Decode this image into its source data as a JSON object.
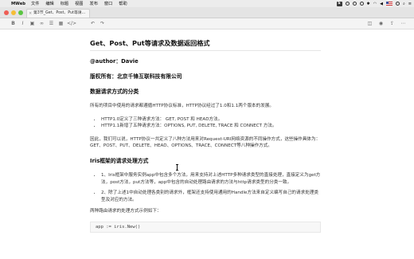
{
  "menubar": {
    "app_name": "MWeb",
    "items": [
      "文件",
      "编辑",
      "标题",
      "视图",
      "发布",
      "窗口",
      "帮助"
    ],
    "status_badge": "S"
  },
  "tab": {
    "title": "第3节_Get、Post、Put等请..."
  },
  "toolbar": {
    "icons": [
      "bold-icon",
      "italic-icon",
      "image-icon",
      "link-icon",
      "list-icon",
      "table-icon",
      "code-icon",
      "undo-icon",
      "redo-icon",
      "split-view-icon",
      "preview-icon",
      "share-icon"
    ]
  },
  "doc": {
    "title": "Get、Post、Put等请求及数据返回格式",
    "author": "@author：Davie",
    "copyright": "版权所有：北京千锋互联科技有限公司",
    "section1_title": "数据请求方式的分类",
    "section1_p1": "所有的项目中使用的请求都遵循HTTP协议标准，HTTP协议经过了1.0和1.1两个版本的发展。",
    "section1_bullets": [
      "HTTP1.0定义了三种请求方法： GET, POST 和 HEAD方法。",
      "HTTP1.1新增了五种请求方法：OPTIONS, PUT, DELETE, TRACE 和 CONNECT 方法。"
    ],
    "section1_p2": "因此，我们可以说，HTTP协议一共定义了八种方法用来对Request-URI网络资源的不同操作方式，这些操作具体为：GET、POST、PUT、DELETE、HEAD、OPTIONS、TRACE、CONNECT等八种操作方式。",
    "section2_title": "Iris框架的请求处理方式",
    "section2_bullets": [
      "1、Iris框架中服务实例app中包含多个方法，用来支持对上述HTTP多种请求类型的直接处理，直接定义为get方法，post方法，put方法等，app中包含的自动处理路由请求的方法与http请求类型的分类一致。",
      "2、除了上述1中自动处理各类别的请求外，框架还支持使用通用的Handle方法来自定义编写自己的请求处理类型及对应的方法。"
    ],
    "section2_p": "两种路由请求的处理方式示例如下：",
    "code": "app := iris.New()"
  }
}
